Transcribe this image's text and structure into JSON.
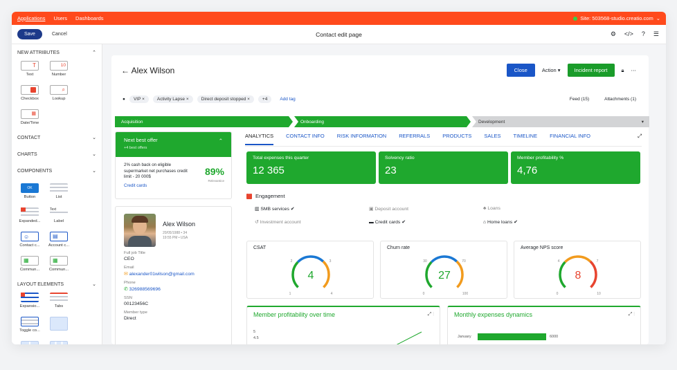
{
  "topbar": {
    "tabs": [
      "Applications",
      "Users",
      "Dashboards"
    ],
    "site": "Site: 503568-studio.creatio.com"
  },
  "toolbar": {
    "save": "Save",
    "cancel": "Cancel",
    "title": "Contact edit page"
  },
  "sidebar": {
    "new_attributes": "NEW ATTRIBUTES",
    "attr_items": [
      "Text",
      "Number",
      "Checkbox",
      "Lookup",
      "Date/Time"
    ],
    "contact": "CONTACT",
    "charts": "CHARTS",
    "components": "COMPONENTS",
    "component_items": [
      "Button",
      "List",
      "Expanded...",
      "Label",
      "Contact c...",
      "Account c...",
      "Commun...",
      "Commun..."
    ],
    "button_preview": "OK",
    "label_preview": "Text",
    "number_preview": "10",
    "layout_elements": "LAYOUT ELEMENTS",
    "layout_items": [
      "Expansio...",
      "Tabs",
      "Toggle co..."
    ]
  },
  "header": {
    "name": "Alex Wilson",
    "close": "Close",
    "action": "Action",
    "incident": "Incident report",
    "tags": [
      "VIP",
      "Activity Lapse",
      "Direct deposit stopped"
    ],
    "more_tags": "+4",
    "add_tag": "Add tag",
    "feed": "Feed (15)",
    "attachments": "Attachments (1)"
  },
  "stages": [
    "Acquisition",
    "Onboarding",
    "Development"
  ],
  "nbo": {
    "title": "Next best offer",
    "sub": "+4 best offers",
    "offer": "2% cash back on eligible supermarket net purchases credit limit - 20 000$",
    "pct": "89%",
    "pct_label": "Relevantice",
    "link": "Credit cards"
  },
  "profile": {
    "name": "Alex Wilson",
    "dob": "20/05/1988 • 34",
    "time": "19:55 PM • USA",
    "fields": [
      {
        "label": "Full job Title",
        "value": "CEO"
      },
      {
        "label": "Email",
        "value": "alexander01wilson@gmail.com"
      },
      {
        "label": "Phone",
        "value": "326988569696"
      },
      {
        "label": "SSN",
        "value": "00123456C"
      },
      {
        "label": "Member type",
        "value": "Direct"
      }
    ]
  },
  "tabs": [
    "ANALYTICS",
    "CONTACT INFO",
    "RISK INFORMATION",
    "REFERRALS",
    "PRODUCTS",
    "SALES",
    "TIMELINE",
    "FINANCIAL INFO"
  ],
  "kpis": [
    {
      "label": "Total expenses this quarter",
      "value": "12 365"
    },
    {
      "label": "Solvency ratio",
      "value": "23"
    },
    {
      "label": "Member profitability %",
      "value": "4,76"
    }
  ],
  "engagement": {
    "title": "Engagement",
    "items": [
      {
        "label": "SMB services",
        "active": true
      },
      {
        "label": "Deposit account",
        "active": false
      },
      {
        "label": "Loans",
        "active": false
      },
      {
        "label": "Investment account",
        "active": false
      },
      {
        "label": "Credit cards",
        "active": true
      },
      {
        "label": "Home loans",
        "active": true
      }
    ]
  },
  "gauges": [
    {
      "title": "CSAT",
      "value": "4",
      "min": "1",
      "max": "4",
      "t1": "2",
      "t2": "3",
      "color": "#1fa82e"
    },
    {
      "title": "Churn rate",
      "value": "27",
      "min": "0",
      "max": "100",
      "t1": "30",
      "t2": "70",
      "color": "#1fa82e"
    },
    {
      "title": "Average NPS score",
      "value": "8",
      "min": "0",
      "max": "10",
      "t1": "4",
      "t2": "7",
      "color": "#e8442f"
    }
  ],
  "charts": {
    "profit": {
      "title": "Member profitability over time",
      "y_ticks": [
        "5",
        "4.5"
      ]
    },
    "expenses": {
      "title": "Monthly expenses dynamics",
      "row_label": "January",
      "row_value": "6000"
    }
  },
  "colors": {
    "accent": "#ff4a1c",
    "green": "#1fa82e",
    "blue": "#1a56c7"
  }
}
